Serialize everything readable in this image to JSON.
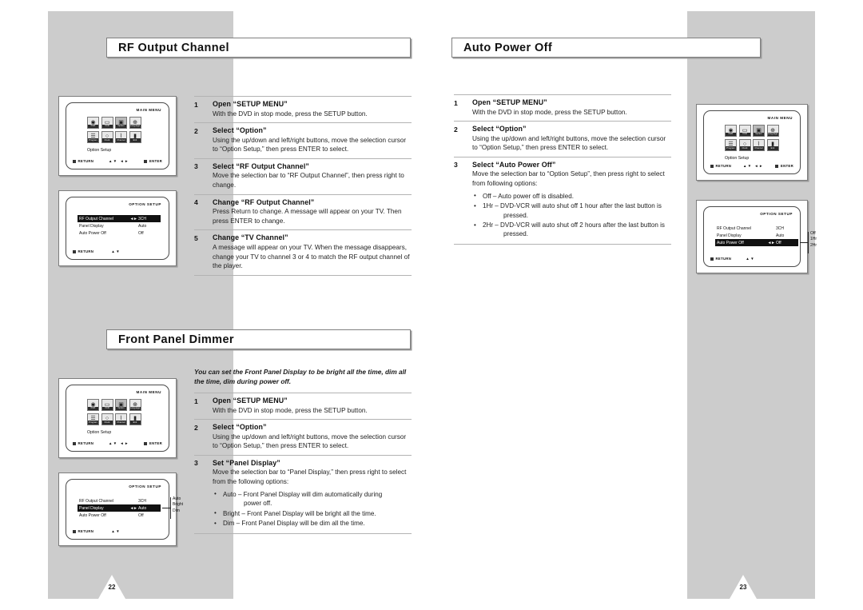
{
  "document": {
    "type": "dvd-vcr-user-manual-spread",
    "left_page_number": "22",
    "right_page_number": "23"
  },
  "sections": {
    "rf_output_channel": {
      "title": "RF Output Channel",
      "steps": [
        {
          "num": "1",
          "head": "Open “SETUP MENU”",
          "text": "With the DVD in stop mode, press the SETUP button."
        },
        {
          "num": "2",
          "head": "Select “Option”",
          "text": "Using the up/down and left/right buttons, move the selection cursor to “Option Setup,” then press ENTER to select."
        },
        {
          "num": "3",
          "head": "Select “RF Output Channel”",
          "text": "Move the selection bar to “RF Output Channel”, then press right to change."
        },
        {
          "num": "4",
          "head": "Change “RF Output Channel”",
          "text": "Press Return to change. A message will appear on your TV. Then press ENTER to change."
        },
        {
          "num": "5",
          "head": "Change “TV Channel”",
          "text": "A message will appear on your TV. When the message disappears, change your TV to channel 3 or 4 to match the RF output channel of the player."
        }
      ]
    },
    "front_panel_dimmer": {
      "title": "Front Panel Dimmer",
      "intro": "You can set the Front Panel Display to be bright all the time, dim all the time, dim during power off.",
      "steps": [
        {
          "num": "1",
          "head": "Open “SETUP MENU”",
          "text": "With the DVD in stop mode, press the SETUP button."
        },
        {
          "num": "2",
          "head": "Select “Option”",
          "text": "Using the up/down and left/right buttons, move the selection cursor to “Option Setup,” then press ENTER to select."
        },
        {
          "num": "3",
          "head": "Set “Panel Display”",
          "text": "Move the selection bar to “Panel Display,” then press right to select from the following options:",
          "bullets": [
            {
              "main": "Auto – Front Panel Display will dim automatically during",
              "cont": "power off."
            },
            {
              "main": "Bright – Front Panel Display will be bright all the time."
            },
            {
              "main": "Dim – Front Panel Display will be dim all the time."
            }
          ]
        }
      ]
    },
    "auto_power_off": {
      "title": "Auto Power Off",
      "steps": [
        {
          "num": "1",
          "head": "Open “SETUP MENU”",
          "text": "With the DVD in stop mode, press the SETUP button."
        },
        {
          "num": "2",
          "head": "Select “Option”",
          "text": "Using the up/down and left/right buttons, move the selection cursor to “Option Setup,” then press ENTER to select."
        },
        {
          "num": "3",
          "head": "Select “Auto Power Off”",
          "text": "Move the selection bar to “Option Setup”, then press right to select from following options:",
          "bullets": [
            {
              "main": "Off  – Auto power off is disabled."
            },
            {
              "main": "1Hr – DVD-VCR will auto shut off 1 hour after the last button is",
              "cont": "pressed."
            },
            {
              "main": "2Hr – DVD-VCR will auto shut off 2 hours after the last button is",
              "cont": "pressed."
            }
          ]
        }
      ]
    }
  },
  "osd": {
    "main_menu": {
      "title": "MAIN MENU",
      "icons": [
        {
          "caption": "DVD",
          "glyph": "◉",
          "selected": false,
          "icon_name": "dvd-disc-icon"
        },
        {
          "caption": "VCR",
          "glyph": "▭",
          "selected": false,
          "icon_name": "vcr-tape-icon"
        },
        {
          "caption": "Option",
          "glyph": "▣",
          "selected": true,
          "icon_name": "option-monitor-icon"
        },
        {
          "caption": "Language",
          "glyph": "⊕",
          "selected": false,
          "icon_name": "language-globe-icon"
        },
        {
          "caption": "Program",
          "glyph": "☰",
          "selected": false,
          "icon_name": "program-list-icon"
        },
        {
          "caption": "Clock",
          "glyph": "○",
          "selected": false,
          "icon_name": "clock-icon"
        },
        {
          "caption": "Channel",
          "glyph": "⌇",
          "selected": false,
          "icon_name": "channel-antenna-icon"
        },
        {
          "caption": "Exit",
          "glyph": "▮",
          "selected": false,
          "icon_name": "exit-door-icon"
        }
      ],
      "status_label": "Option Setup",
      "footer_return": "RETURN",
      "footer_arrows": "▲▼ ◄►",
      "footer_enter": "ENTER"
    },
    "option_setup": {
      "title": "OPTION SETUP",
      "footer_return": "RETURN",
      "footer_arrows": "▲▼",
      "rows": [
        {
          "name": "RF Output Channel",
          "value": "3CH"
        },
        {
          "name": "Panel Display",
          "value": "Auto"
        },
        {
          "name": "Auto Power Off",
          "value": "Off"
        }
      ],
      "lr_marker": "◄►"
    },
    "screens": {
      "rf_option_setup": {
        "highlight_index": 0,
        "callout": []
      },
      "panel_option_setup": {
        "highlight_index": 1,
        "callout": [
          "Auto",
          "Bright",
          "Dim"
        ]
      },
      "apo_option_setup": {
        "highlight_index": 2,
        "callout": [
          "Off",
          "1Hr",
          "2Hr"
        ]
      }
    }
  },
  "colors": {
    "page_gray": "#cccccc",
    "rule_gray": "#b3b3b3",
    "title_border": "#808080",
    "osd_highlight": "#111111",
    "icon_face": "#e8e8e8",
    "icon_selected": "#b9b9b9"
  }
}
